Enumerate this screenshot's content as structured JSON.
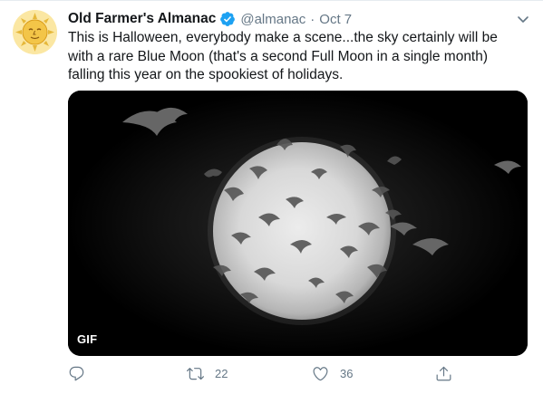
{
  "tweet": {
    "author_name": "Old Farmer's Almanac",
    "handle": "@almanac",
    "separator": "·",
    "date": "Oct 7",
    "text": "This is Halloween, everybody make a scene...the sky certainly will be with a rare Blue Moon (that's a second Full Moon in a single month) falling this year on the spookiest of holidays.",
    "media": {
      "badge": "GIF",
      "description_icon": "moon-with-bats-gif"
    },
    "actions": {
      "reply_count": "",
      "retweet_count": "22",
      "like_count": "36",
      "share_count": ""
    }
  },
  "icons": {
    "avatar": "sun-face-icon",
    "verified": "verified-badge-icon",
    "more": "chevron-down-icon",
    "reply": "reply-icon",
    "retweet": "retweet-icon",
    "like": "heart-icon",
    "share": "share-icon"
  },
  "colors": {
    "accent": "#1da1f2",
    "text_primary": "#14171a",
    "text_secondary": "#657786",
    "border": "#e6ecf0"
  }
}
